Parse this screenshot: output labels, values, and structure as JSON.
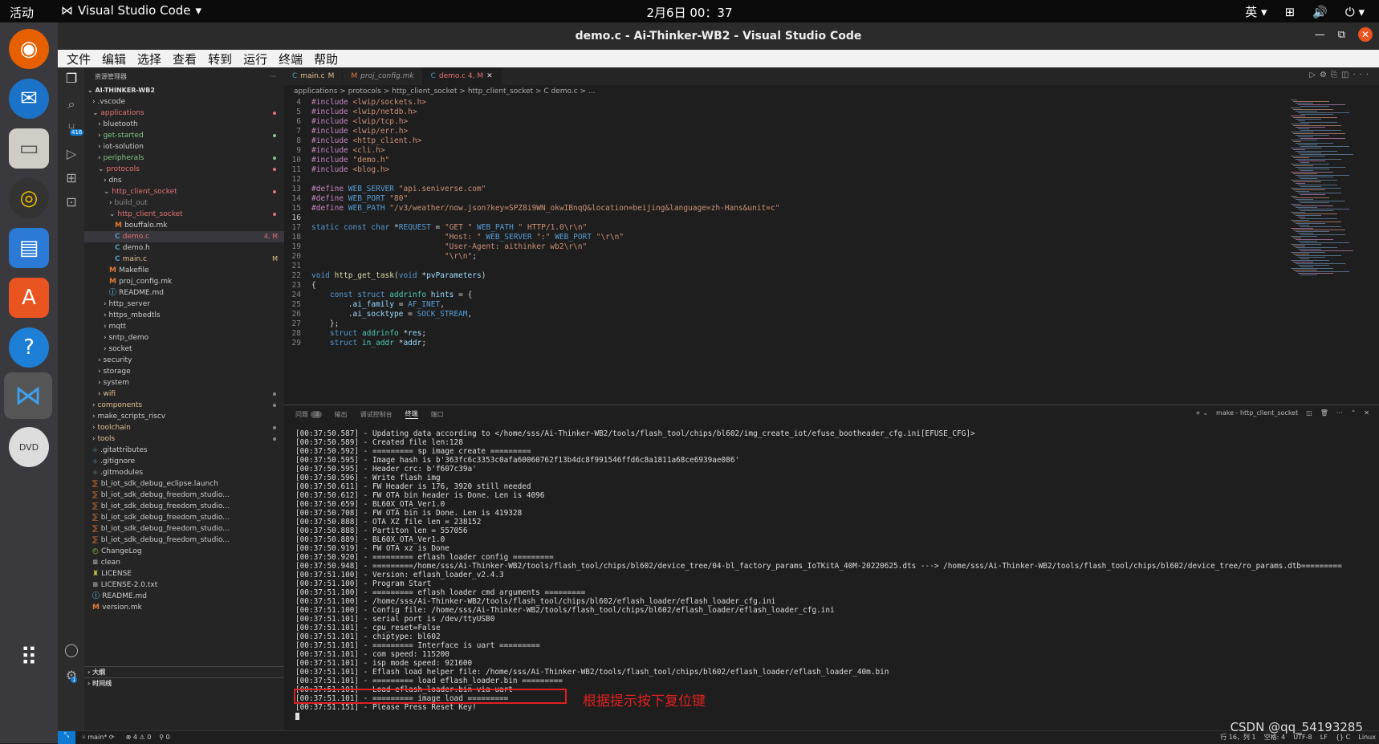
{
  "topbar": {
    "activities": "活动",
    "app": "Visual Studio Code",
    "clock": "2月6日  00：37",
    "ime": "英"
  },
  "window": {
    "title": "demo.c - Ai-Thinker-WB2 - Visual Studio Code"
  },
  "menu": [
    "文件",
    "编辑",
    "选择",
    "查看",
    "转到",
    "运行",
    "终端",
    "帮助"
  ],
  "activity": {
    "scm_badge": "416",
    "settings_badge": "1"
  },
  "sidebar": {
    "title": "资源管理器",
    "root": "AI-THINKER-WB2",
    "items": [
      {
        "label": ".vscode",
        "indent": 1,
        "kind": "folder",
        "open": false
      },
      {
        "label": "applications",
        "indent": 1,
        "kind": "folder",
        "open": true,
        "color": "#e57373",
        "dot": "#e57373"
      },
      {
        "label": "bluetooth",
        "indent": 2,
        "kind": "folder",
        "open": false
      },
      {
        "label": "get-started",
        "indent": 2,
        "kind": "folder",
        "open": false,
        "color": "#81c784",
        "dot": "#81c784"
      },
      {
        "label": "iot-solution",
        "indent": 2,
        "kind": "folder",
        "open": false
      },
      {
        "label": "peripherals",
        "indent": 2,
        "kind": "folder",
        "open": false,
        "color": "#81c784",
        "dot": "#81c784"
      },
      {
        "label": "protocols",
        "indent": 2,
        "kind": "folder",
        "open": true,
        "color": "#e57373",
        "dot": "#e57373"
      },
      {
        "label": "dns",
        "indent": 3,
        "kind": "folder",
        "open": false
      },
      {
        "label": "http_client_socket",
        "indent": 3,
        "kind": "folder",
        "open": true,
        "color": "#e57373",
        "dot": "#e57373"
      },
      {
        "label": "build_out",
        "indent": 4,
        "kind": "folder",
        "open": false,
        "color": "#888"
      },
      {
        "label": "http_client_socket",
        "indent": 4,
        "kind": "folder",
        "open": true,
        "color": "#e57373",
        "dot": "#e57373"
      },
      {
        "label": "bouffalo.mk",
        "indent": 5,
        "kind": "mk"
      },
      {
        "label": "demo.c",
        "indent": 5,
        "kind": "c",
        "color": "#e57373",
        "badge": "4, M",
        "selected": true
      },
      {
        "label": "demo.h",
        "indent": 5,
        "kind": "c"
      },
      {
        "label": "main.c",
        "indent": 5,
        "kind": "c",
        "color": "#e2c08d",
        "badge": "M"
      },
      {
        "label": "Makefile",
        "indent": 4,
        "kind": "mk"
      },
      {
        "label": "proj_config.mk",
        "indent": 4,
        "kind": "mk"
      },
      {
        "label": "README.md",
        "indent": 4,
        "kind": "info"
      },
      {
        "label": "http_server",
        "indent": 3,
        "kind": "folder",
        "open": false
      },
      {
        "label": "https_mbedtls",
        "indent": 3,
        "kind": "folder",
        "open": false
      },
      {
        "label": "mqtt",
        "indent": 3,
        "kind": "folder",
        "open": false
      },
      {
        "label": "sntp_demo",
        "indent": 3,
        "kind": "folder",
        "open": false
      },
      {
        "label": "socket",
        "indent": 3,
        "kind": "folder",
        "open": false
      },
      {
        "label": "security",
        "indent": 2,
        "kind": "folder",
        "open": false
      },
      {
        "label": "storage",
        "indent": 2,
        "kind": "folder",
        "open": false
      },
      {
        "label": "system",
        "indent": 2,
        "kind": "folder",
        "open": false
      },
      {
        "label": "wifi",
        "indent": 2,
        "kind": "folder",
        "open": false,
        "color": "#e2c08d",
        "dot": "#888"
      },
      {
        "label": "components",
        "indent": 1,
        "kind": "folder",
        "open": false,
        "color": "#e2c08d",
        "dot": "#888"
      },
      {
        "label": "make_scripts_riscv",
        "indent": 1,
        "kind": "folder",
        "open": false
      },
      {
        "label": "toolchain",
        "indent": 1,
        "kind": "folder",
        "open": false,
        "color": "#e2c08d",
        "dot": "#888"
      },
      {
        "label": "tools",
        "indent": 1,
        "kind": "folder",
        "open": false,
        "color": "#e2c08d",
        "dot": "#888"
      },
      {
        "label": ".gitattributes",
        "indent": 1,
        "kind": "git"
      },
      {
        "label": ".gitignore",
        "indent": 1,
        "kind": "git"
      },
      {
        "label": ".gitmodules",
        "indent": 1,
        "kind": "git"
      },
      {
        "label": "bl_iot_sdk_debug_eclipse.launch",
        "indent": 1,
        "kind": "rss"
      },
      {
        "label": "bl_iot_sdk_debug_freedom_studio...",
        "indent": 1,
        "kind": "rss"
      },
      {
        "label": "bl_iot_sdk_debug_freedom_studio...",
        "indent": 1,
        "kind": "rss"
      },
      {
        "label": "bl_iot_sdk_debug_freedom_studio...",
        "indent": 1,
        "kind": "rss"
      },
      {
        "label": "bl_iot_sdk_debug_freedom_studio...",
        "indent": 1,
        "kind": "rss"
      },
      {
        "label": "bl_iot_sdk_debug_freedom_studio...",
        "indent": 1,
        "kind": "rss"
      },
      {
        "label": "ChangeLog",
        "indent": 1,
        "kind": "clock"
      },
      {
        "label": "clean",
        "indent": 1,
        "kind": "lines"
      },
      {
        "label": "LICENSE",
        "indent": 1,
        "kind": "lic"
      },
      {
        "label": "LICENSE-2.0.txt",
        "indent": 1,
        "kind": "lines"
      },
      {
        "label": "README.md",
        "indent": 1,
        "kind": "info"
      },
      {
        "label": "version.mk",
        "indent": 1,
        "kind": "mk"
      }
    ],
    "outline": "大纲",
    "timeline": "时间线"
  },
  "tabs": [
    {
      "label": "main.c",
      "flag": "M",
      "active": false,
      "italic": false
    },
    {
      "label": "proj_config.mk",
      "flag": "",
      "active": false,
      "italic": true
    },
    {
      "label": "demo.c 4, M",
      "flag": "",
      "active": true,
      "italic": false
    }
  ],
  "breadcrumb": "applications  >  protocols  >  http_client_socket  >  http_client_socket  >  C  demo.c  >  ...",
  "code": [
    {
      "n": "4",
      "t": "#include <lwip/sockets.h>"
    },
    {
      "n": "5",
      "t": "#include <lwip/netdb.h>"
    },
    {
      "n": "6",
      "t": "#include <lwip/tcp.h>"
    },
    {
      "n": "7",
      "t": "#include <lwip/err.h>"
    },
    {
      "n": "8",
      "t": "#include <http_client.h>"
    },
    {
      "n": "9",
      "t": "#include <cli.h>"
    },
    {
      "n": "10",
      "t": "#include \"demo.h\""
    },
    {
      "n": "11",
      "t": "#include <blog.h>"
    },
    {
      "n": "12",
      "t": ""
    },
    {
      "n": "13",
      "t": "#define WEB_SERVER \"api.seniverse.com\""
    },
    {
      "n": "14",
      "t": "#define WEB_PORT \"80\""
    },
    {
      "n": "15",
      "t": "#define WEB_PATH \"/v3/weather/now.json?key=SPZ8i9WN_okwIBnqQ&location=beijing&language=zh-Hans&unit=c\""
    },
    {
      "n": "16",
      "t": ""
    },
    {
      "n": "17",
      "t": "static const char *REQUEST = \"GET \" WEB_PATH \" HTTP/1.0\\r\\n\""
    },
    {
      "n": "18",
      "t": "                             \"Host: \" WEB_SERVER \":\" WEB_PORT \"\\r\\n\""
    },
    {
      "n": "19",
      "t": "                             \"User-Agent: aithinker wb2\\r\\n\""
    },
    {
      "n": "20",
      "t": "                             \"\\r\\n\";"
    },
    {
      "n": "21",
      "t": ""
    },
    {
      "n": "22",
      "t": "void http_get_task(void *pvParameters)"
    },
    {
      "n": "23",
      "t": "{"
    },
    {
      "n": "24",
      "t": "    const struct addrinfo hints = {"
    },
    {
      "n": "25",
      "t": "        .ai_family = AF_INET,"
    },
    {
      "n": "26",
      "t": "        .ai_socktype = SOCK_STREAM,"
    },
    {
      "n": "27",
      "t": "    };"
    },
    {
      "n": "28",
      "t": "    struct addrinfo *res;"
    },
    {
      "n": "29",
      "t": "    struct in_addr *addr;"
    }
  ],
  "panel": {
    "tabs": [
      "问题",
      "输出",
      "调试控制台",
      "终端",
      "端口"
    ],
    "problems_count": "4",
    "active": "终端",
    "task": "make - http_client_socket"
  },
  "terminal": [
    "[00:37:50.587] - Updating data according to </home/sss/Ai-Thinker-WB2/tools/flash_tool/chips/bl602/img_create_iot/efuse_bootheader_cfg.ini[EFUSE_CFG]>",
    "[00:37:50.589] - Created file len:128",
    "[00:37:50.592] - ========= sp image create =========",
    "[00:37:50.595] - Image hash is b'363fc6c3353c0afa60060762f13b4dc8f991546ffd6c8a1811a68ce6939ae086'",
    "[00:37:50.595] - Header crc: b'f607c39a'",
    "[00:37:50.596] - Write flash img",
    "[00:37:50.611] - FW Header is 176, 3920 still needed",
    "[00:37:50.612] - FW OTA bin header is Done. Len is 4096",
    "[00:37:50.659] - BL60X_OTA_Ver1.0",
    "[00:37:50.708] - FW OTA bin is Done. Len is 419328",
    "[00:37:50.888] - OTA XZ file len = 238152",
    "[00:37:50.888] - Partiton len = 557056",
    "[00:37:50.889] - BL60X_OTA_Ver1.0",
    "[00:37:50.919] - FW OTA xz is Done",
    "[00:37:50.920] - ========= eflash loader config =========",
    "[00:37:50.948] - =========/home/sss/Ai-Thinker-WB2/tools/flash_tool/chips/bl602/device_tree/04-bl_factory_params_IoTKitA_40M-20220625.dts ---> /home/sss/Ai-Thinker-WB2/tools/flash_tool/chips/bl602/device_tree/ro_params.dtb=========",
    "[00:37:51.100] - Version: eflash_loader_v2.4.3",
    "[00:37:51.100] - Program Start",
    "[00:37:51.100] - ========= eflash loader cmd arguments =========",
    "[00:37:51.100] - /home/sss/Ai-Thinker-WB2/tools/flash_tool/chips/bl602/eflash_loader/eflash_loader_cfg.ini",
    "[00:37:51.100] - Config file: /home/sss/Ai-Thinker-WB2/tools/flash_tool/chips/bl602/eflash_loader/eflash_loader_cfg.ini",
    "[00:37:51.101] - serial port is /dev/ttyUSB0",
    "[00:37:51.101] - cpu_reset=False",
    "[00:37:51.101] - chiptype: bl602",
    "[00:37:51.101] - ========= Interface is uart =========",
    "[00:37:51.101] - com speed: 115200",
    "[00:37:51.101] - isp mode speed: 921600",
    "[00:37:51.101] - Eflash load helper file: /home/sss/Ai-Thinker-WB2/tools/flash_tool/chips/bl602/eflash_loader/eflash_loader_40m.bin",
    "[00:37:51.101] - ========= load eflash_loader.bin =========",
    "[00:37:51.101] - Load eflash_loader.bin via uart",
    "[00:37:51.101] - ========= image load =========",
    "[00:37:51.151] - Please Press Reset Key!"
  ],
  "annotation": "根据提示按下复位键",
  "status": {
    "branch": "main*",
    "errors": "⊗ 4 ⚠ 0",
    "ports": "⚲ 0",
    "right": "行 16，列 1    空格: 4    UTF-8    LF    {} C    Linux"
  },
  "watermark": "CSDN @qq_54193285"
}
